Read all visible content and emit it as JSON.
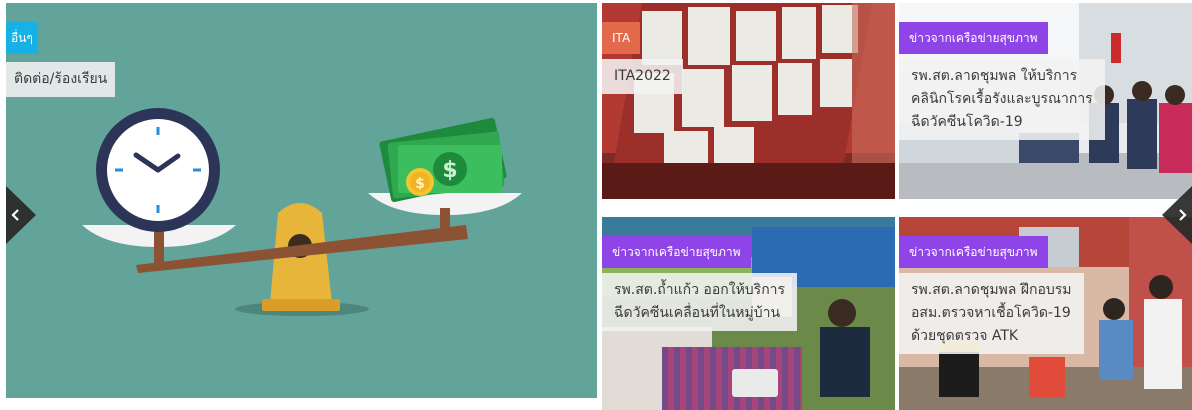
{
  "colors": {
    "main_bg": "#62a39a",
    "tag_other": "#18b1e6",
    "tag_ita": "#e26a4a",
    "tag_network": "#8e44e6"
  },
  "slides": [
    {
      "tag": "อื่นๆ",
      "caption_lines": [
        "ติดต่อ/ร้องเรียน"
      ],
      "image_icon": "clock-money-scale-illustration"
    },
    {
      "tag": "ITA",
      "caption_lines": [
        "ITA2022"
      ],
      "image_icon": "bulletin-board-photo"
    },
    {
      "tag": "ข่าวจากเครือข่ายสุขภาพ",
      "caption_lines": [
        "รพ.สต.ลาดชุมพล ให้บริการ",
        "คลินิกโรคเรื้อรังและบูรณาการ",
        "ฉีดวัคซีนโควิด-19"
      ],
      "image_icon": "clinic-waiting-room-photo"
    },
    {
      "tag": "ข่าวจากเครือข่ายสุขภาพ",
      "caption_lines": [
        "รพ.สต.ถ้ำแก้ว ออกให้บริการ",
        "ฉีดวัคซีนเคลื่อนที่ในหมู่บ้าน"
      ],
      "image_icon": "mobile-vaccination-photo"
    },
    {
      "tag": "ข่าวจากเครือข่ายสุขภาพ",
      "caption_lines": [
        "รพ.สต.ลาดชุมพล ฝึกอบรม",
        "อสม.ตรวจหาเชื้อโควิด-19",
        "ด้วยชุดตรวจ ATK"
      ],
      "image_icon": "atk-training-photo"
    }
  ],
  "nav": {
    "prev_icon": "chevron-left-icon",
    "next_icon": "chevron-right-icon"
  }
}
